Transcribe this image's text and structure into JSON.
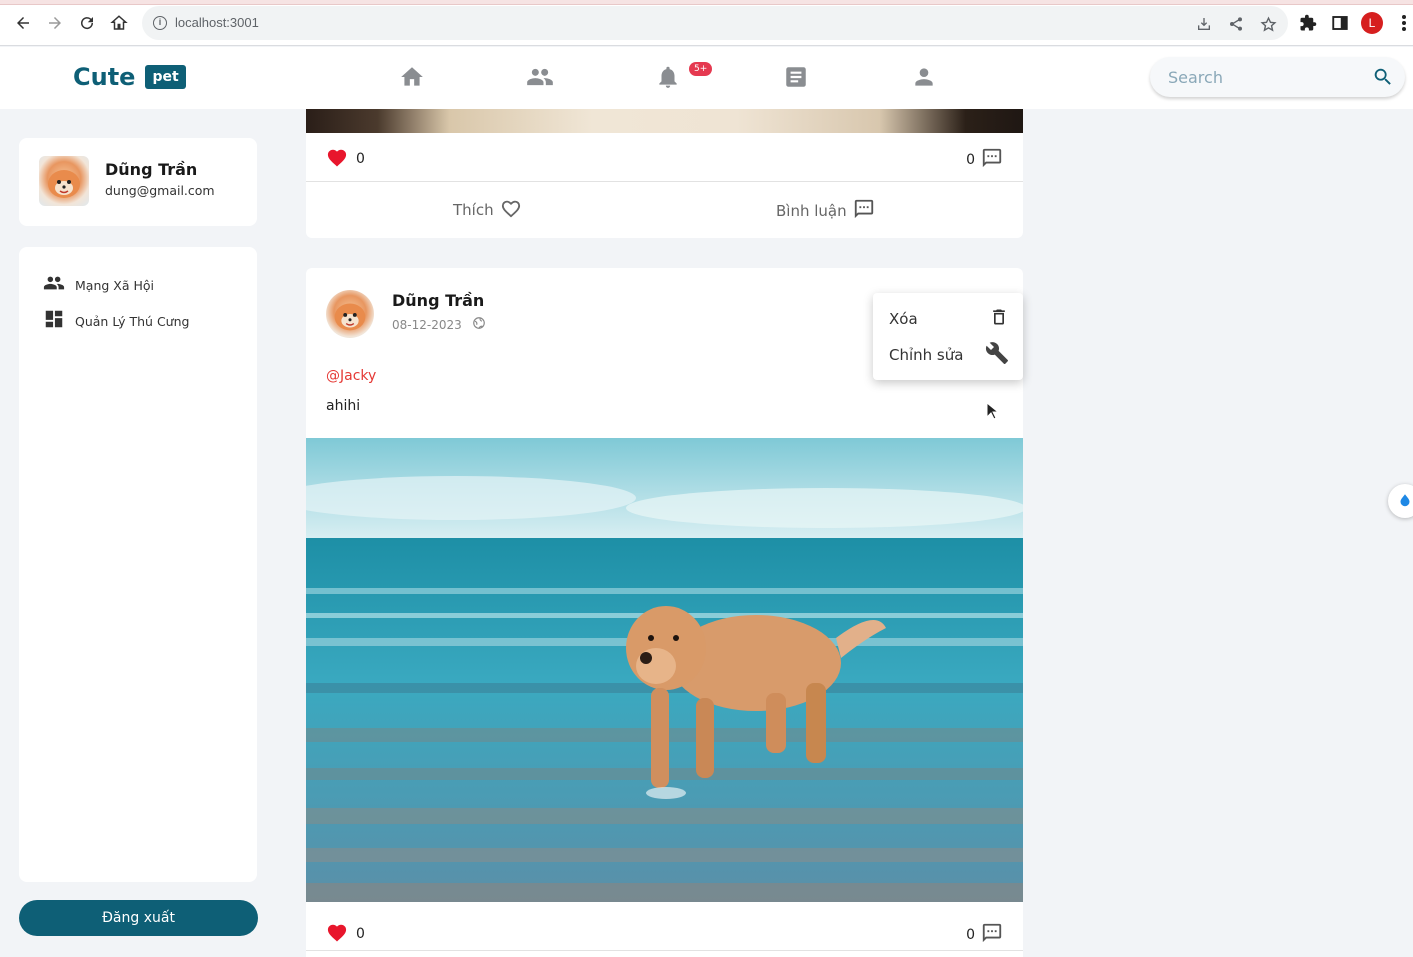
{
  "browser": {
    "url": "localhost:3001",
    "profile_initial": "L"
  },
  "header": {
    "logo_text": "Cute",
    "logo_badge": "pet",
    "notification_badge": "5+",
    "search_placeholder": "Search",
    "nav_icons": [
      "home-icon",
      "people-icon",
      "bell-icon",
      "article-icon",
      "person-icon"
    ]
  },
  "sidebar": {
    "user_name": "Dũng Trần",
    "user_email": "dung@gmail.com",
    "items": [
      {
        "label": "Mạng Xã Hội",
        "icon": "people-icon"
      },
      {
        "label": "Quản Lý Thú Cưng",
        "icon": "dashboard-icon"
      }
    ],
    "logout_label": "Đăng xuất"
  },
  "previous_post": {
    "like_count": "0",
    "comment_count": "0",
    "like_label": "Thích",
    "comment_label": "Bình luận"
  },
  "post": {
    "author": "Dũng Trần",
    "date": "08-12-2023",
    "mention": "@Jacky",
    "text": "ahihi",
    "like_count": "0",
    "comment_count": "0"
  },
  "post_menu": {
    "delete_label": "Xóa",
    "edit_label": "Chỉnh sửa"
  },
  "colors": {
    "brand": "#0e5f76",
    "like_red": "#e8162c",
    "mention_red": "#e53935",
    "badge": "#e53950"
  }
}
